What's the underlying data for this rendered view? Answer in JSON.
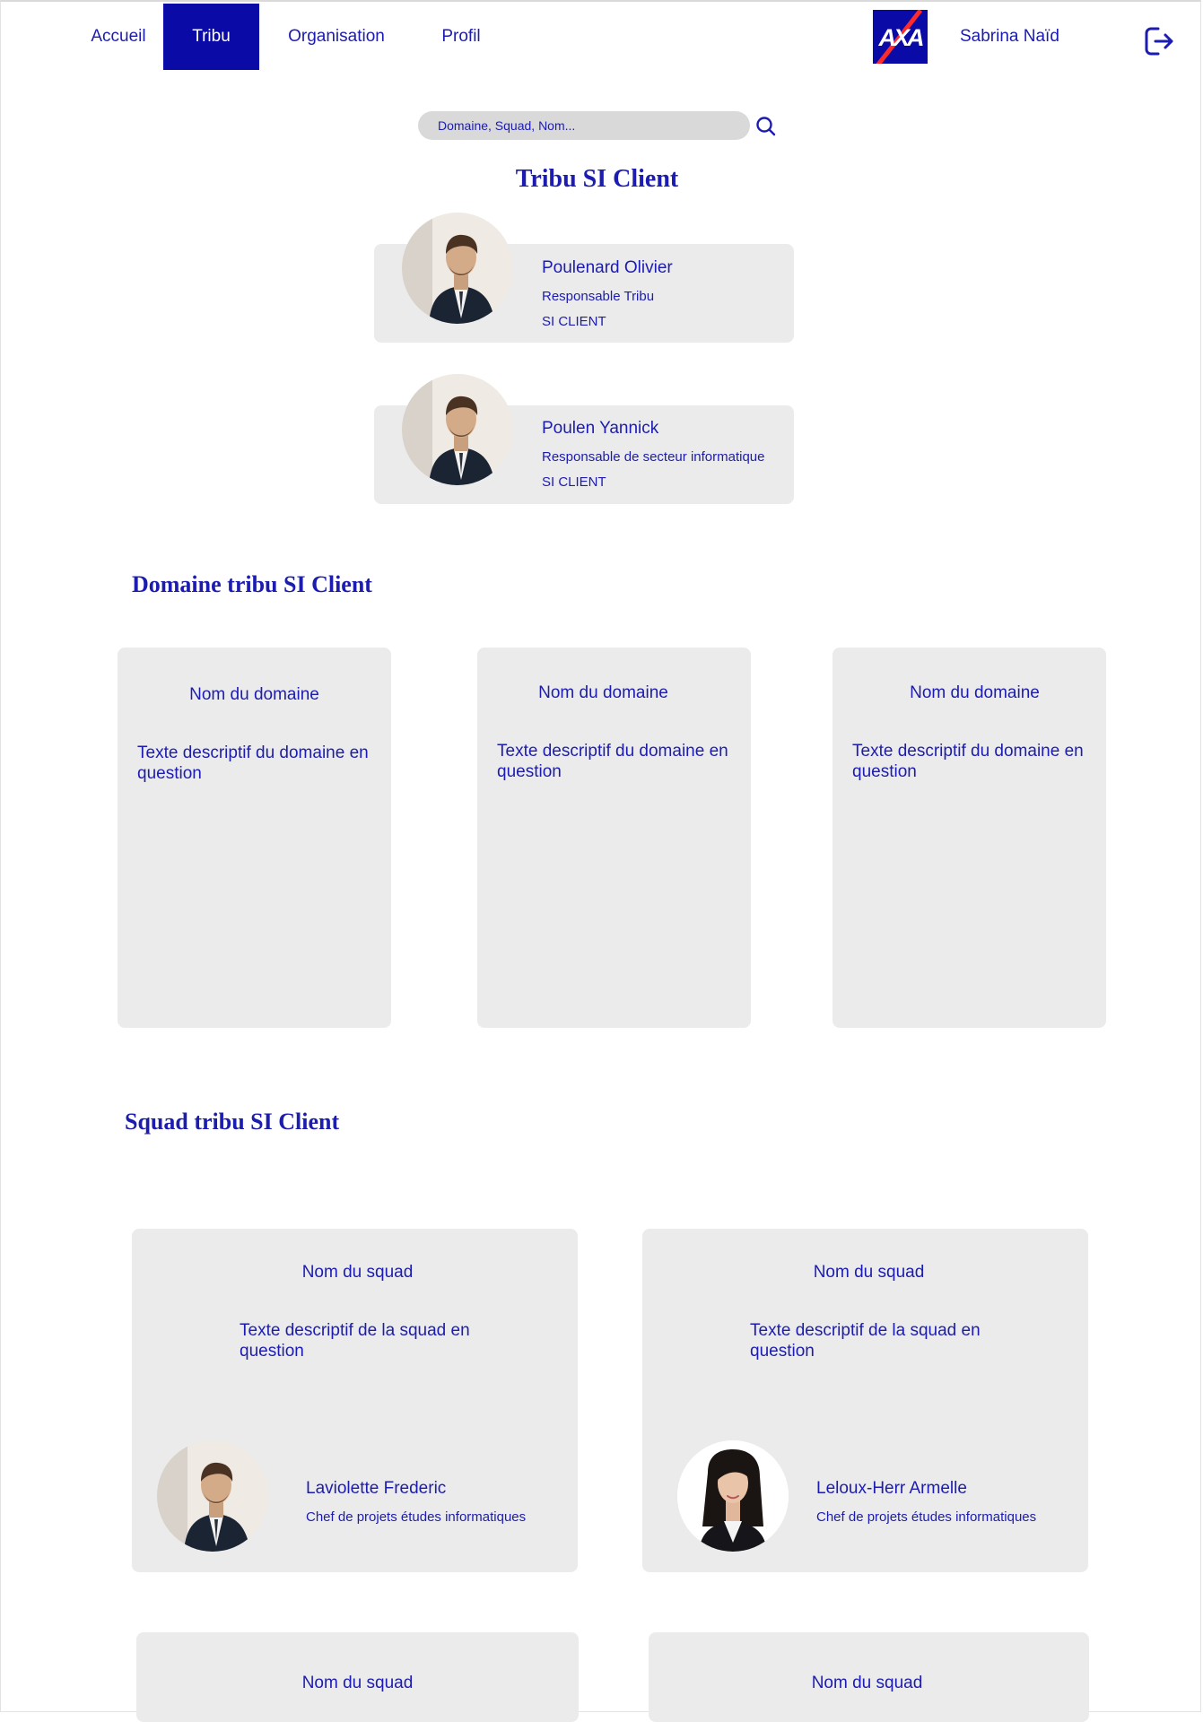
{
  "nav": {
    "items": [
      {
        "label": "Accueil"
      },
      {
        "label": "Tribu"
      },
      {
        "label": "Organisation"
      },
      {
        "label": "Profil"
      }
    ],
    "active": "Tribu",
    "user_name": "Sabrina Naïd",
    "brand_color": "#0a0aa6"
  },
  "search": {
    "placeholder": "Domaine, Squad, Nom...",
    "value": ""
  },
  "tribe": {
    "title": "Tribu SI Client",
    "leaders": [
      {
        "name": "Poulenard Olivier",
        "role": "Responsable Tribu",
        "team": "SI CLIENT"
      },
      {
        "name": "Poulen Yannick",
        "role": "Responsable de secteur informatique",
        "team": "SI CLIENT"
      }
    ]
  },
  "domains": {
    "title": "Domaine tribu SI Client",
    "items": [
      {
        "name": "Nom du domaine",
        "description": "Texte descriptif du domaine en question"
      },
      {
        "name": "Nom du domaine",
        "description": "Texte descriptif du domaine en question"
      },
      {
        "name": "Nom du domaine",
        "description": "Texte descriptif du domaine en question"
      }
    ]
  },
  "squads": {
    "title": "Squad tribu SI Client",
    "items": [
      {
        "name": "Nom du squad",
        "description": "Texte descriptif de la squad en question",
        "lead_name": "Laviolette Frederic",
        "lead_role": "Chef de projets études informatiques"
      },
      {
        "name": "Nom du squad",
        "description": "Texte descriptif de la squad en question",
        "lead_name": "Leloux-Herr Armelle",
        "lead_role": "Chef de projets études informatiques"
      },
      {
        "name": "Nom du squad"
      },
      {
        "name": "Nom du squad"
      }
    ]
  },
  "colors": {
    "text": "#1c1cb0",
    "card_bg": "#ebebeb",
    "logo_accent": "#ff2a2a"
  }
}
